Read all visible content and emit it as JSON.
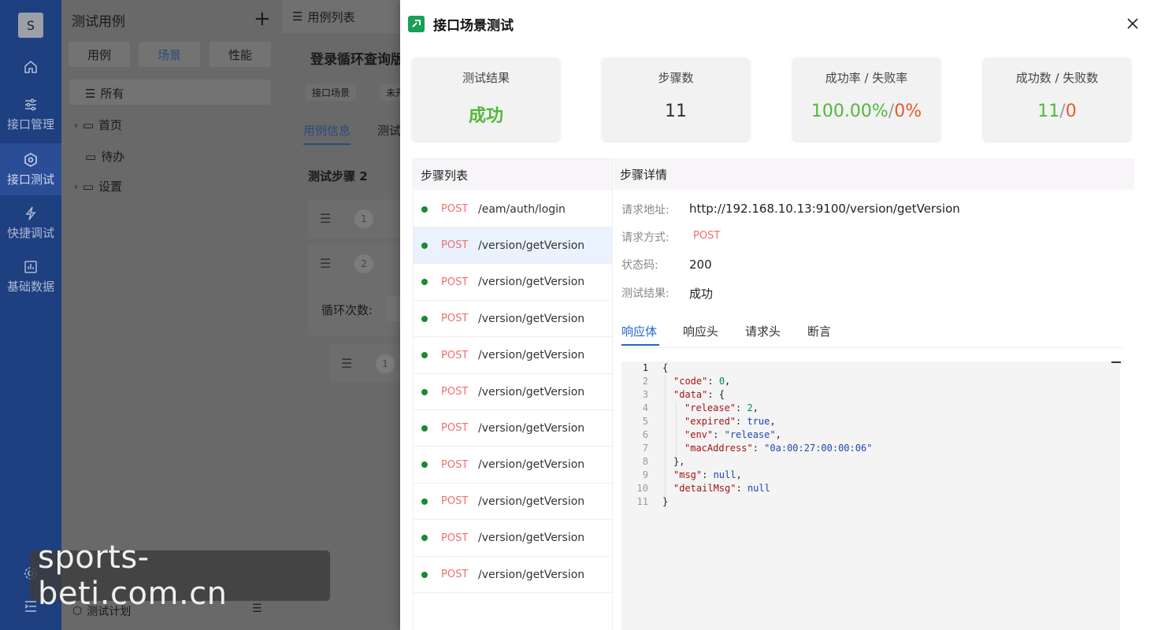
{
  "rail": {
    "avatar": "S",
    "items": [
      {
        "label": "接口管理"
      },
      {
        "label": "接口测试"
      },
      {
        "label": "快捷调试"
      },
      {
        "label": "基础数据"
      }
    ]
  },
  "sidebar": {
    "title": "测试用例",
    "segments": [
      "用例",
      "场景",
      "性能"
    ],
    "tree": [
      "所有",
      "首页",
      "待办",
      "设置"
    ],
    "bottom_item": "测试计划"
  },
  "main": {
    "topbar_label": "用例列表",
    "case_title": "登录循环查询版",
    "tags": [
      "接口场景",
      "未开"
    ],
    "tabs": [
      "用例信息",
      "测试"
    ],
    "steps_title": "测试步骤 2",
    "step_numbers": [
      "1",
      "2",
      "1"
    ],
    "loop_label": "循环次数:"
  },
  "drawer": {
    "title": "接口场景测试",
    "stats": {
      "result_label": "测试结果",
      "result_value": "成功",
      "steps_label": "步骤数",
      "steps_value": "11",
      "rate_label": "成功率 / 失败率",
      "success_rate": "100.00%",
      "fail_rate": "0%",
      "count_label": "成功数 / 失败数",
      "success_count": "11",
      "fail_count": "0",
      "separator": "/"
    },
    "steps_list": {
      "header": "步骤列表",
      "items": [
        {
          "method": "POST",
          "path": "/eam/auth/login"
        },
        {
          "method": "POST",
          "path": "/version/getVersion"
        },
        {
          "method": "POST",
          "path": "/version/getVersion"
        },
        {
          "method": "POST",
          "path": "/version/getVersion"
        },
        {
          "method": "POST",
          "path": "/version/getVersion"
        },
        {
          "method": "POST",
          "path": "/version/getVersion"
        },
        {
          "method": "POST",
          "path": "/version/getVersion"
        },
        {
          "method": "POST",
          "path": "/version/getVersion"
        },
        {
          "method": "POST",
          "path": "/version/getVersion"
        },
        {
          "method": "POST",
          "path": "/version/getVersion"
        },
        {
          "method": "POST",
          "path": "/version/getVersion"
        }
      ],
      "selected_index": 1
    },
    "detail": {
      "header": "步骤详情",
      "url_label": "请求地址:",
      "url_value": "http://192.168.10.13:9100/version/getVersion",
      "method_label": "请求方式:",
      "method_value": "POST",
      "status_label": "状态码:",
      "status_value": "200",
      "result_label": "测试结果:",
      "result_value": "成功",
      "tabs": [
        "响应体",
        "响应头",
        "请求头",
        "断言"
      ],
      "active_tab": 0
    },
    "response": {
      "line_numbers": [
        "1",
        "2",
        "3",
        "4",
        "5",
        "6",
        "7",
        "8",
        "9",
        "10",
        "11"
      ],
      "code": 0,
      "release": 2,
      "expired": "true",
      "env": "release",
      "macAddress": "0a:00:27:00:00:06",
      "msg": "null",
      "detailMsg": "null"
    }
  },
  "watermark": "sports-beti.com.cn"
}
